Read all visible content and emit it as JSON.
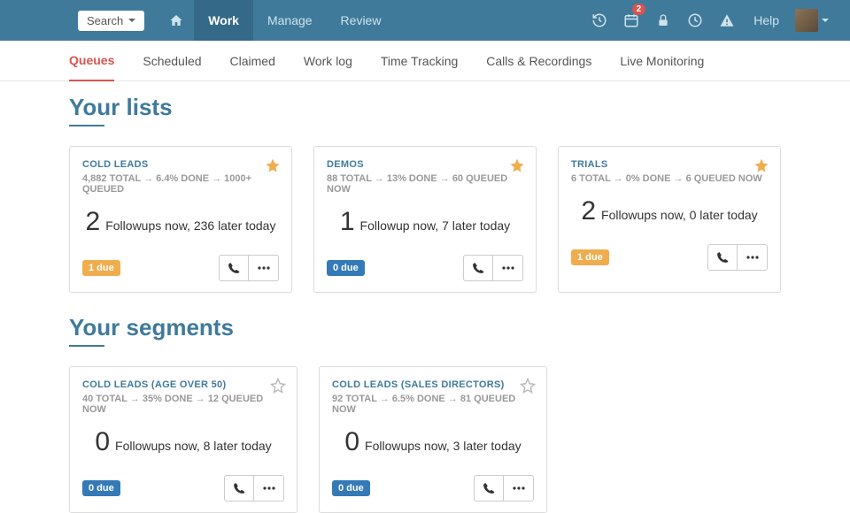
{
  "topbar": {
    "search_label": "Search",
    "nav": [
      "Work",
      "Manage",
      "Review"
    ],
    "calendar_badge": "2",
    "help_label": "Help"
  },
  "subnav": {
    "items": [
      "Queues",
      "Scheduled",
      "Claimed",
      "Work log",
      "Time Tracking",
      "Calls & Recordings",
      "Live Monitoring"
    ]
  },
  "sections": {
    "lists_title": "Your lists",
    "segments_title": "Your segments"
  },
  "lists": [
    {
      "title": "COLD LEADS",
      "stats": "4,882 TOTAL → 6.4% DONE → 1000+ QUEUED",
      "big": "2",
      "followup": "Followups now, 236 later today",
      "due_label": "1 due",
      "due_style": "yellow",
      "starred": true
    },
    {
      "title": "DEMOS",
      "stats": "88 TOTAL → 13% DONE → 60 QUEUED NOW",
      "big": "1",
      "followup": "Followup now, 7 later today",
      "due_label": "0 due",
      "due_style": "blue",
      "starred": true
    },
    {
      "title": "TRIALS",
      "stats": "6 TOTAL → 0% DONE → 6 QUEUED NOW",
      "big": "2",
      "followup": "Followups now, 0 later today",
      "due_label": "1 due",
      "due_style": "yellow",
      "starred": true
    }
  ],
  "segments": [
    {
      "title": "COLD LEADS (AGE OVER 50)",
      "stats": "40 TOTAL → 35% DONE → 12 QUEUED NOW",
      "big": "0",
      "followup": "Followups now, 8 later today",
      "due_label": "0 due",
      "due_style": "blue",
      "starred": false
    },
    {
      "title": "COLD LEADS (SALES DIRECTORS)",
      "stats": "92 TOTAL → 6.5% DONE → 81 QUEUED NOW",
      "big": "0",
      "followup": "Followups now, 3 later today",
      "due_label": "0 due",
      "due_style": "blue",
      "starred": false
    }
  ]
}
